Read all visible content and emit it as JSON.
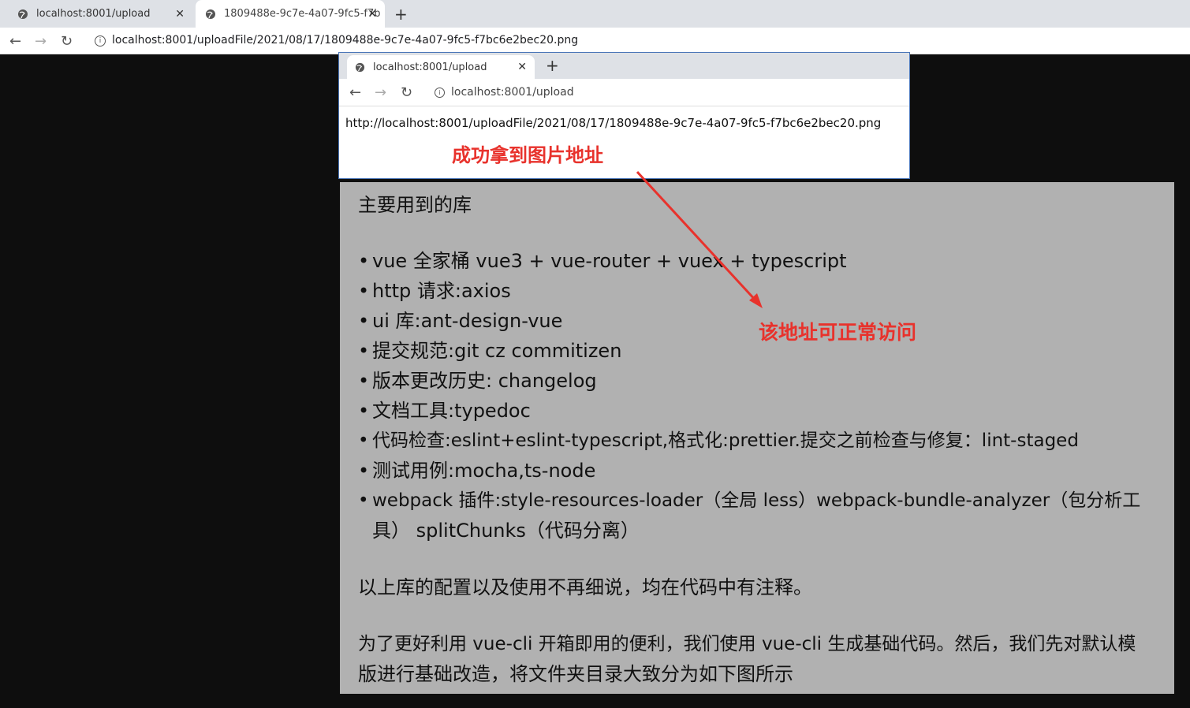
{
  "outer_browser": {
    "tabs": [
      {
        "label": "localhost:8001/upload"
      },
      {
        "label": "1809488e-9c7e-4a07-9fc5-f7b"
      }
    ],
    "url": "localhost:8001/uploadFile/2021/08/17/1809488e-9c7e-4a07-9fc5-f7bc6e2bec20.png"
  },
  "inner_browser": {
    "tab_label": "localhost:8001/upload",
    "url": "localhost:8001/upload",
    "body_text": "http://localhost:8001/uploadFile/2021/08/17/1809488e-9c7e-4a07-9fc5-f7bc6e2bec20.png"
  },
  "annotations": {
    "success": "成功拿到图片地址",
    "accessible": "该地址可正常访问"
  },
  "article": {
    "heading": "主要用到的库",
    "items": [
      "vue 全家桶 vue3 + vue-router + vuex + typescript",
      "http 请求:axios",
      "ui 库:ant-design-vue",
      "提交规范:git cz commitizen",
      "版本更改历史: changelog",
      "文档工具:typedoc",
      "代码检查:eslint+eslint-typescript,格式化:prettier.提交之前检查与修复：lint-staged",
      "测试用例:mocha,ts-node",
      "webpack 插件:style-resources-loader（全局 less）webpack-bundle-analyzer（包分析工",
      "具） splitChunks（代码分离）"
    ],
    "para1": "以上库的配置以及使用不再细说，均在代码中有注释。",
    "para2_line1": "为了更好利用 vue-cli 开箱即用的便利，我们使用 vue-cli 生成基础代码。然后，我们先对默认模",
    "para2_line2": "版进行基础改造，将文件夹目录大致分为如下图所示"
  },
  "colors": {
    "annotation": "#e8322c",
    "article_bg": "#b1b1b1",
    "background": "#0e0e0e"
  }
}
